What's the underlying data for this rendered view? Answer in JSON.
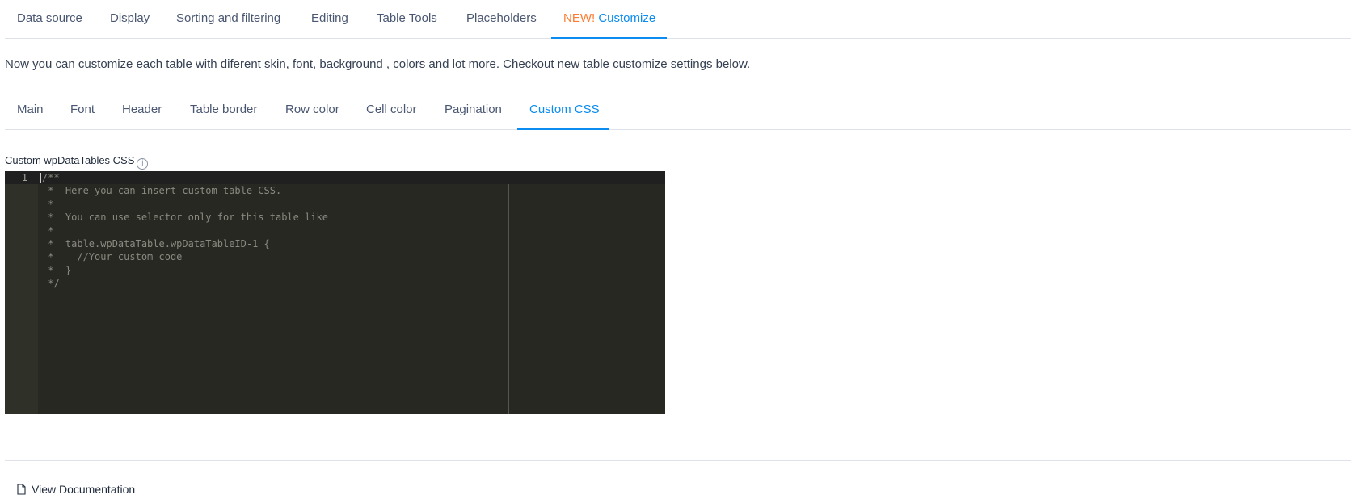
{
  "main_tabs": {
    "data_source": "Data source",
    "display": "Display",
    "sorting": "Sorting and filtering",
    "editing": "Editing",
    "table_tools": "Table Tools",
    "placeholders": "Placeholders",
    "customize_new": "NEW!",
    "customize": "Customize"
  },
  "description": "Now you can customize each table with diferent skin, font, background , colors and lot more. Checkout new table customize settings below.",
  "sub_tabs": {
    "main": "Main",
    "font": "Font",
    "header": "Header",
    "table_border": "Table border",
    "row_color": "Row color",
    "cell_color": "Cell color",
    "pagination": "Pagination",
    "custom_css": "Custom CSS"
  },
  "custom_css": {
    "label": "Custom wpDataTables CSS",
    "info_icon": "i",
    "line_number": "1",
    "code": "/**\n *  Here you can insert custom table CSS.\n *\n *  You can use selector only for this table like\n *\n *  table.wpDataTable.wpDataTableID-1 {\n *    //Your custom code\n *  }\n */"
  },
  "footer": {
    "view_documentation": "View Documentation"
  },
  "colors": {
    "accent": "#0a8cf0",
    "new_badge": "#ff7a2f",
    "editor_bg": "#272822"
  }
}
